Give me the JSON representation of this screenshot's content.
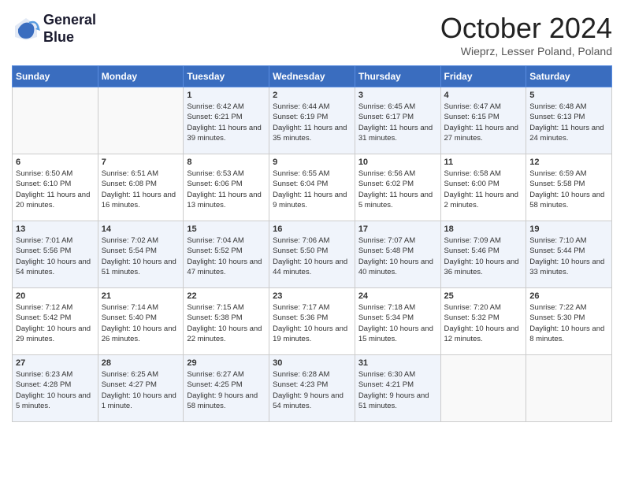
{
  "logo": {
    "line1": "General",
    "line2": "Blue"
  },
  "title": "October 2024",
  "subtitle": "Wieprz, Lesser Poland, Poland",
  "weekdays": [
    "Sunday",
    "Monday",
    "Tuesday",
    "Wednesday",
    "Thursday",
    "Friday",
    "Saturday"
  ],
  "weeks": [
    [
      {
        "day": "",
        "info": ""
      },
      {
        "day": "",
        "info": ""
      },
      {
        "day": "1",
        "info": "Sunrise: 6:42 AM\nSunset: 6:21 PM\nDaylight: 11 hours and 39 minutes."
      },
      {
        "day": "2",
        "info": "Sunrise: 6:44 AM\nSunset: 6:19 PM\nDaylight: 11 hours and 35 minutes."
      },
      {
        "day": "3",
        "info": "Sunrise: 6:45 AM\nSunset: 6:17 PM\nDaylight: 11 hours and 31 minutes."
      },
      {
        "day": "4",
        "info": "Sunrise: 6:47 AM\nSunset: 6:15 PM\nDaylight: 11 hours and 27 minutes."
      },
      {
        "day": "5",
        "info": "Sunrise: 6:48 AM\nSunset: 6:13 PM\nDaylight: 11 hours and 24 minutes."
      }
    ],
    [
      {
        "day": "6",
        "info": "Sunrise: 6:50 AM\nSunset: 6:10 PM\nDaylight: 11 hours and 20 minutes."
      },
      {
        "day": "7",
        "info": "Sunrise: 6:51 AM\nSunset: 6:08 PM\nDaylight: 11 hours and 16 minutes."
      },
      {
        "day": "8",
        "info": "Sunrise: 6:53 AM\nSunset: 6:06 PM\nDaylight: 11 hours and 13 minutes."
      },
      {
        "day": "9",
        "info": "Sunrise: 6:55 AM\nSunset: 6:04 PM\nDaylight: 11 hours and 9 minutes."
      },
      {
        "day": "10",
        "info": "Sunrise: 6:56 AM\nSunset: 6:02 PM\nDaylight: 11 hours and 5 minutes."
      },
      {
        "day": "11",
        "info": "Sunrise: 6:58 AM\nSunset: 6:00 PM\nDaylight: 11 hours and 2 minutes."
      },
      {
        "day": "12",
        "info": "Sunrise: 6:59 AM\nSunset: 5:58 PM\nDaylight: 10 hours and 58 minutes."
      }
    ],
    [
      {
        "day": "13",
        "info": "Sunrise: 7:01 AM\nSunset: 5:56 PM\nDaylight: 10 hours and 54 minutes."
      },
      {
        "day": "14",
        "info": "Sunrise: 7:02 AM\nSunset: 5:54 PM\nDaylight: 10 hours and 51 minutes."
      },
      {
        "day": "15",
        "info": "Sunrise: 7:04 AM\nSunset: 5:52 PM\nDaylight: 10 hours and 47 minutes."
      },
      {
        "day": "16",
        "info": "Sunrise: 7:06 AM\nSunset: 5:50 PM\nDaylight: 10 hours and 44 minutes."
      },
      {
        "day": "17",
        "info": "Sunrise: 7:07 AM\nSunset: 5:48 PM\nDaylight: 10 hours and 40 minutes."
      },
      {
        "day": "18",
        "info": "Sunrise: 7:09 AM\nSunset: 5:46 PM\nDaylight: 10 hours and 36 minutes."
      },
      {
        "day": "19",
        "info": "Sunrise: 7:10 AM\nSunset: 5:44 PM\nDaylight: 10 hours and 33 minutes."
      }
    ],
    [
      {
        "day": "20",
        "info": "Sunrise: 7:12 AM\nSunset: 5:42 PM\nDaylight: 10 hours and 29 minutes."
      },
      {
        "day": "21",
        "info": "Sunrise: 7:14 AM\nSunset: 5:40 PM\nDaylight: 10 hours and 26 minutes."
      },
      {
        "day": "22",
        "info": "Sunrise: 7:15 AM\nSunset: 5:38 PM\nDaylight: 10 hours and 22 minutes."
      },
      {
        "day": "23",
        "info": "Sunrise: 7:17 AM\nSunset: 5:36 PM\nDaylight: 10 hours and 19 minutes."
      },
      {
        "day": "24",
        "info": "Sunrise: 7:18 AM\nSunset: 5:34 PM\nDaylight: 10 hours and 15 minutes."
      },
      {
        "day": "25",
        "info": "Sunrise: 7:20 AM\nSunset: 5:32 PM\nDaylight: 10 hours and 12 minutes."
      },
      {
        "day": "26",
        "info": "Sunrise: 7:22 AM\nSunset: 5:30 PM\nDaylight: 10 hours and 8 minutes."
      }
    ],
    [
      {
        "day": "27",
        "info": "Sunrise: 6:23 AM\nSunset: 4:28 PM\nDaylight: 10 hours and 5 minutes."
      },
      {
        "day": "28",
        "info": "Sunrise: 6:25 AM\nSunset: 4:27 PM\nDaylight: 10 hours and 1 minute."
      },
      {
        "day": "29",
        "info": "Sunrise: 6:27 AM\nSunset: 4:25 PM\nDaylight: 9 hours and 58 minutes."
      },
      {
        "day": "30",
        "info": "Sunrise: 6:28 AM\nSunset: 4:23 PM\nDaylight: 9 hours and 54 minutes."
      },
      {
        "day": "31",
        "info": "Sunrise: 6:30 AM\nSunset: 4:21 PM\nDaylight: 9 hours and 51 minutes."
      },
      {
        "day": "",
        "info": ""
      },
      {
        "day": "",
        "info": ""
      }
    ]
  ]
}
